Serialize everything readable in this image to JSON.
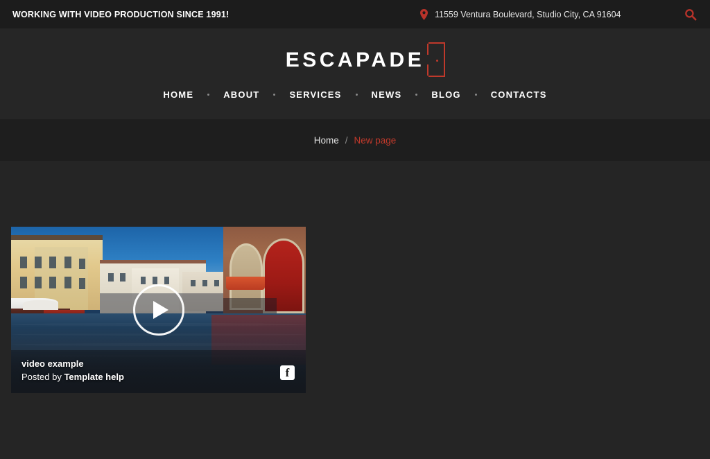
{
  "topbar": {
    "tagline": "WORKING WITH VIDEO PRODUCTION SINCE 1991!",
    "address": "11559 Ventura Boulevard, Studio City, CA 91604",
    "pin_icon": "map-pin-icon",
    "search_icon": "search-icon",
    "accent_color": "#c0392b",
    "background": "#1c1c1c"
  },
  "header": {
    "logo": "ESCAPADE",
    "logo_accent_color": "#c0392b",
    "background": "#262626",
    "nav": [
      {
        "label": "HOME"
      },
      {
        "label": "ABOUT"
      },
      {
        "label": "SERVICES"
      },
      {
        "label": "NEWS"
      },
      {
        "label": "BLOG"
      },
      {
        "label": "CONTACTS"
      }
    ]
  },
  "breadcrumb": {
    "home": "Home",
    "separator": "/",
    "current": "New page",
    "current_color": "#c0392b",
    "background": "#1e1e1e"
  },
  "main": {
    "background": "#252525"
  },
  "video_card": {
    "title": "video example",
    "posted_by_prefix": "Posted by",
    "author": "Template help",
    "play_icon": "play-icon",
    "share_icon": "facebook-icon",
    "scene_description": "Venice canal with boats and red-arched building"
  }
}
